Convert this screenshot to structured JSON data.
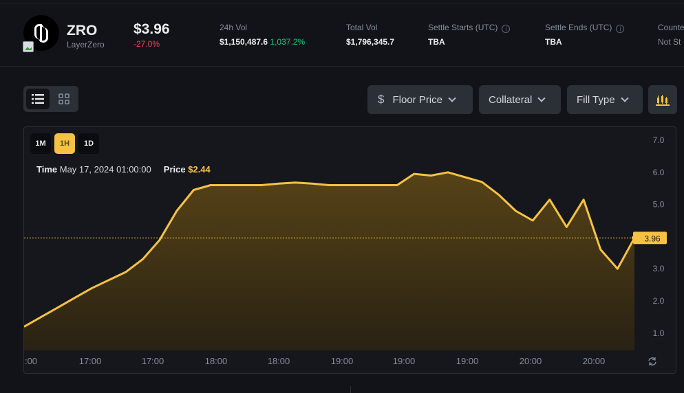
{
  "asset": {
    "symbol": "ZRO",
    "name": "LayerZero",
    "price": "$3.96",
    "change": "-27.0%"
  },
  "stats": [
    {
      "label": "24h Vol",
      "value": "$1,150,487.6",
      "extra": "1,037.2%"
    },
    {
      "label": "Total Vol",
      "value": "$1,796,345.7"
    },
    {
      "label": "Settle Starts (UTC)",
      "value": "TBA",
      "info": "i"
    },
    {
      "label": "Settle Ends (UTC)",
      "value": "TBA",
      "info": "i"
    },
    {
      "label": "Counte",
      "value": "Not St"
    }
  ],
  "view_toggle": {
    "list_icon": "list-icon",
    "grid_icon": "grid-icon"
  },
  "filters": {
    "floor_price": "Floor Price",
    "collateral": "Collateral",
    "fill_type": "Fill Type",
    "dollar_symbol": "$"
  },
  "intervals": [
    "1M",
    "1H",
    "1D"
  ],
  "active_interval": "1H",
  "tooltip": {
    "time_label": "Time",
    "time_value": "May 17, 2024 01:00:00",
    "price_label": "Price",
    "price_value": "$2.44"
  },
  "colors": {
    "accent": "#f5c244",
    "up": "#0ecb81",
    "down": "#f6465d",
    "background": "#121318"
  },
  "chart_data": {
    "type": "area",
    "y_ticks": [
      "7.0",
      "6.0",
      "5.0",
      "3.0",
      "2.0",
      "1.0"
    ],
    "ylim": [
      0.5,
      7.0
    ],
    "x_ticks": [
      ":00",
      "17:00",
      "17:00",
      "18:00",
      "18:00",
      "19:00",
      "19:00",
      "19:00",
      "20:00",
      "20:00"
    ],
    "current_price_label": "3.96",
    "current_price": 3.96,
    "series": [
      {
        "values": [
          1.2,
          1.5,
          1.8,
          2.1,
          2.4,
          2.65,
          2.9,
          3.3,
          3.9,
          4.8,
          5.45,
          5.6,
          5.6,
          5.6,
          5.6,
          5.65,
          5.68,
          5.65,
          5.6,
          5.6,
          5.6,
          5.6,
          5.6,
          5.95,
          5.9,
          6.0,
          5.85,
          5.7,
          5.3,
          4.8,
          4.5,
          5.15,
          4.3,
          5.15,
          3.6,
          3.0,
          3.96
        ]
      }
    ]
  }
}
